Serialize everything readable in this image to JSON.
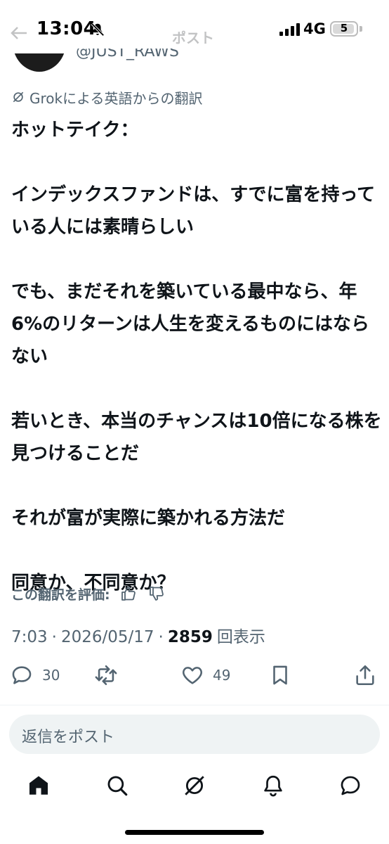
{
  "status_bar": {
    "time": "13:04",
    "network": "4G",
    "battery_level": "5"
  },
  "header": {
    "title": "ポスト"
  },
  "author": {
    "handle": "@JUST_RAWS"
  },
  "translation_note": "Grokによる英語からの翻訳",
  "post": {
    "paragraphs": [
      "ホットテイク：",
      "インデックスファンドは、すでに富を持っている人には素晴らしい",
      "でも、まだそれを築いている最中なら、年6%のリターンは人生を変えるものにはならない",
      "若いとき、本当のチャンスは10倍になる株を見つけることだ",
      "それが富が実際に築かれる方法だ",
      "同意か、不同意か？"
    ]
  },
  "rate_translation": {
    "label": "この翻訳を評価:"
  },
  "meta": {
    "time": "7:03",
    "sep1": "·",
    "date": "2026/05/17",
    "sep2": "·",
    "views_count": "2859",
    "views_label": "回表示"
  },
  "actions": {
    "reply_count": "30",
    "like_count": "49"
  },
  "reply_box": {
    "placeholder": "返信をポスト"
  },
  "icons": {
    "status": [
      "bell-slash-icon",
      "signal-icon",
      "battery-icon"
    ],
    "actions": [
      "reply-icon",
      "repost-icon",
      "like-icon",
      "bookmark-icon",
      "share-icon"
    ],
    "nav": [
      "home-icon",
      "search-icon",
      "grok-icon",
      "notifications-icon",
      "messages-icon"
    ]
  },
  "colors": {
    "text": "#0f1419",
    "secondary": "#536471",
    "reply_bg": "#eff3f4"
  }
}
